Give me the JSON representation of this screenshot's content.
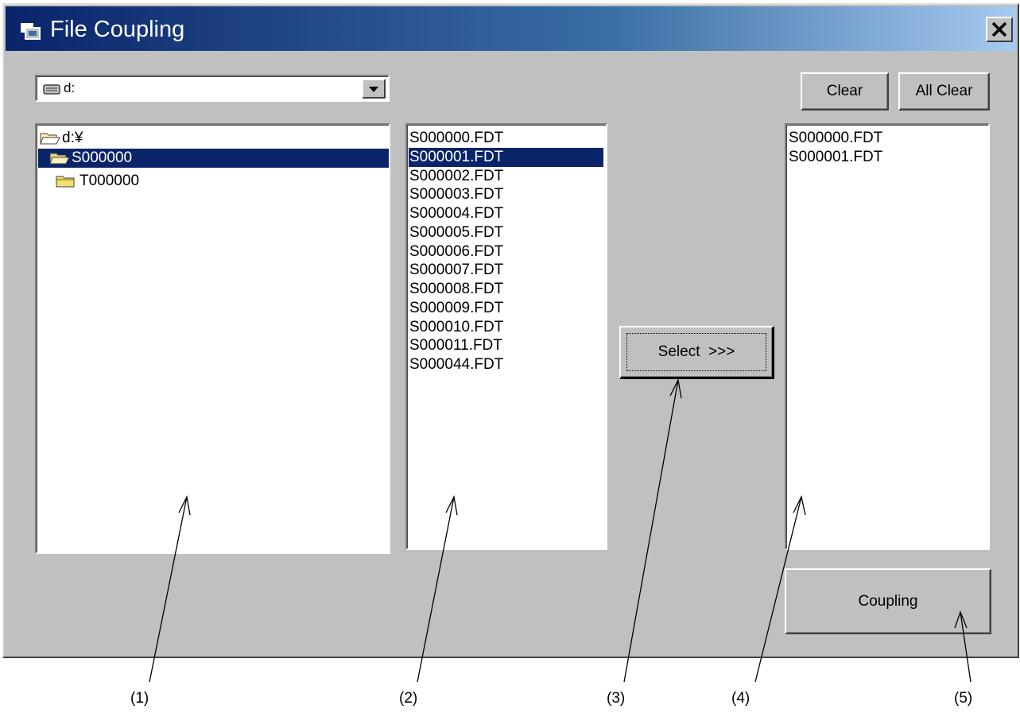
{
  "window": {
    "title": "File Coupling",
    "close_label": "✕"
  },
  "drive_select": {
    "value": "d:"
  },
  "folder_tree": {
    "items": [
      {
        "label": "d:¥",
        "icon": "open-folder-icon",
        "selected": false
      },
      {
        "label": "S000000",
        "icon": "open-folder-icon",
        "selected": true
      },
      {
        "label": "T000000",
        "icon": "folder-icon",
        "selected": false
      }
    ]
  },
  "file_list": {
    "items": [
      "S000000.FDT",
      "S000001.FDT",
      "S000002.FDT",
      "S000003.FDT",
      "S000004.FDT",
      "S000005.FDT",
      "S000006.FDT",
      "S000007.FDT",
      "S000008.FDT",
      "S000009.FDT",
      "S000010.FDT",
      "S000011.FDT",
      "S000044.FDT"
    ],
    "selected_index": 1
  },
  "selected_list": {
    "items": [
      "S000000.FDT",
      "S000001.FDT"
    ]
  },
  "buttons": {
    "select": "Select  >>>",
    "clear": "Clear",
    "all_clear": "All Clear",
    "coupling": "Coupling"
  },
  "callouts": [
    "(1)",
    "(2)",
    "(3)",
    "(4)",
    "(5)"
  ],
  "colors": {
    "face": "#c0c0c0",
    "selection": "#0a246a",
    "title_start": "#0a246a",
    "title_end": "#a6caf0"
  }
}
